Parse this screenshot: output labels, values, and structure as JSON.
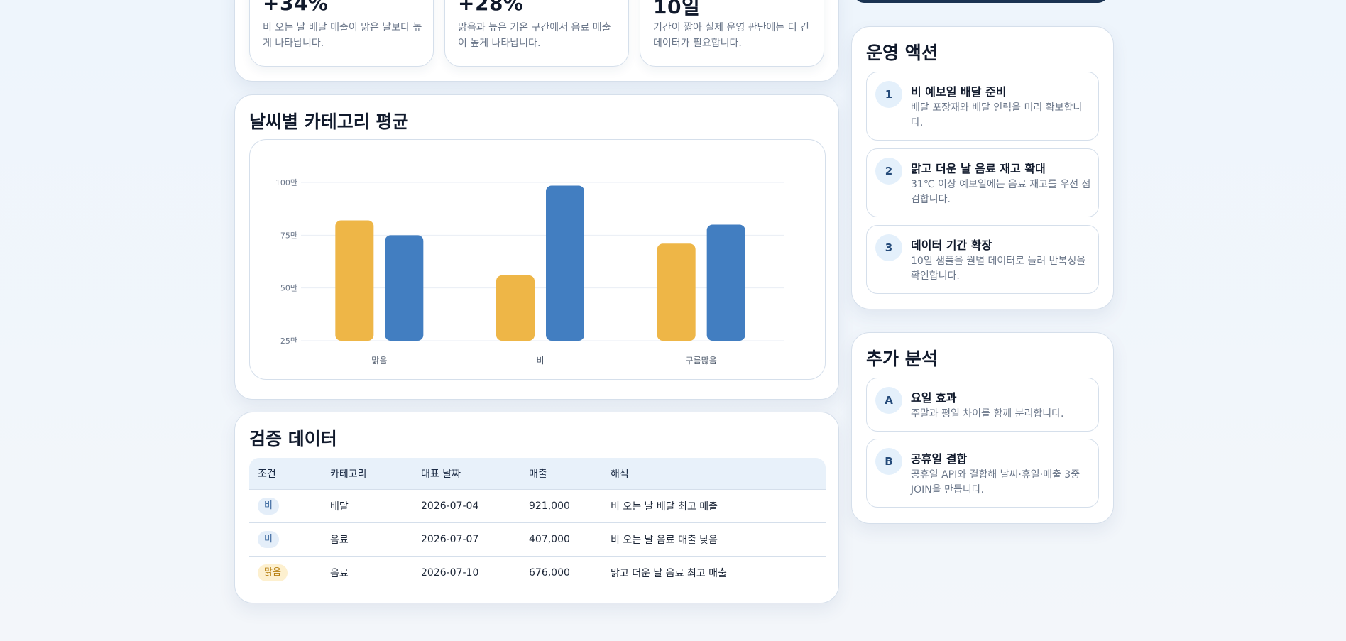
{
  "kpis": [
    {
      "value": "+34%",
      "desc": "비 오는 날 배달 매출이 맑은 날보다 높게 나타납니다."
    },
    {
      "value": "+28%",
      "desc": "맑음과 높은 기온 구간에서 음료 매출이 높게 나타납니다."
    },
    {
      "value": "10일",
      "desc": "기간이 짧아 실제 운영 판단에는 더 긴 데이터가 필요합니다."
    }
  ],
  "chart_card": {
    "title": "날씨별 카테고리 평균"
  },
  "chart_data": {
    "type": "bar",
    "categories": [
      "맑음",
      "비",
      "구름많음"
    ],
    "series": [
      {
        "values": [
          820000,
          560000,
          710000
        ],
        "color": "#eeb647"
      },
      {
        "values": [
          750000,
          985000,
          800000
        ],
        "color": "#427ec1"
      }
    ],
    "y_ticks": [
      250000,
      500000,
      750000,
      1000000
    ],
    "y_tick_labels": [
      "25만",
      "50만",
      "75만",
      "100만"
    ],
    "ylim": [
      250000,
      1000000
    ],
    "grid": true
  },
  "table_card": {
    "title": "검증 데이터",
    "headers": [
      "조건",
      "카테고리",
      "대표 날짜",
      "매출",
      "해석"
    ],
    "rows": [
      {
        "condition": "비",
        "category": "배달",
        "date": "2026-07-04",
        "sales": "921,000",
        "note": "비 오는 날 배달 최고 매출"
      },
      {
        "condition": "비",
        "category": "음료",
        "date": "2026-07-07",
        "sales": "407,000",
        "note": "비 오는 날 음료 매출 낮음"
      },
      {
        "condition": "맑음",
        "category": "음료",
        "date": "2026-07-10",
        "sales": "676,000",
        "note": "맑고 더운 날 음료 최고 매출"
      }
    ]
  },
  "actions_card": {
    "title": "운영 액션",
    "items": [
      {
        "num": "1",
        "title": "비 예보일 배달 준비",
        "desc": "배달 포장재와 배달 인력을 미리 확보합니다."
      },
      {
        "num": "2",
        "title": "맑고 더운 날 음료 재고 확대",
        "desc": "31℃ 이상 예보일에는 음료 재고를 우선 점검합니다."
      },
      {
        "num": "3",
        "title": "데이터 기간 확장",
        "desc": "10일 샘플을 월별 데이터로 늘려 반복성을 확인합니다."
      }
    ]
  },
  "analysis_card": {
    "title": "추가 분석",
    "items": [
      {
        "num": "A",
        "title": "요일 효과",
        "desc": "주말과 평일 차이를 함께 분리합니다."
      },
      {
        "num": "B",
        "title": "공휴일 결합",
        "desc": "공휴일 API와 결합해 날씨·휴일·매출 3중 JOIN을 만듭니다."
      }
    ]
  },
  "colors": {
    "accent_blue": "#427ec1",
    "accent_yellow": "#eeb647",
    "navy": "#1b3352"
  }
}
